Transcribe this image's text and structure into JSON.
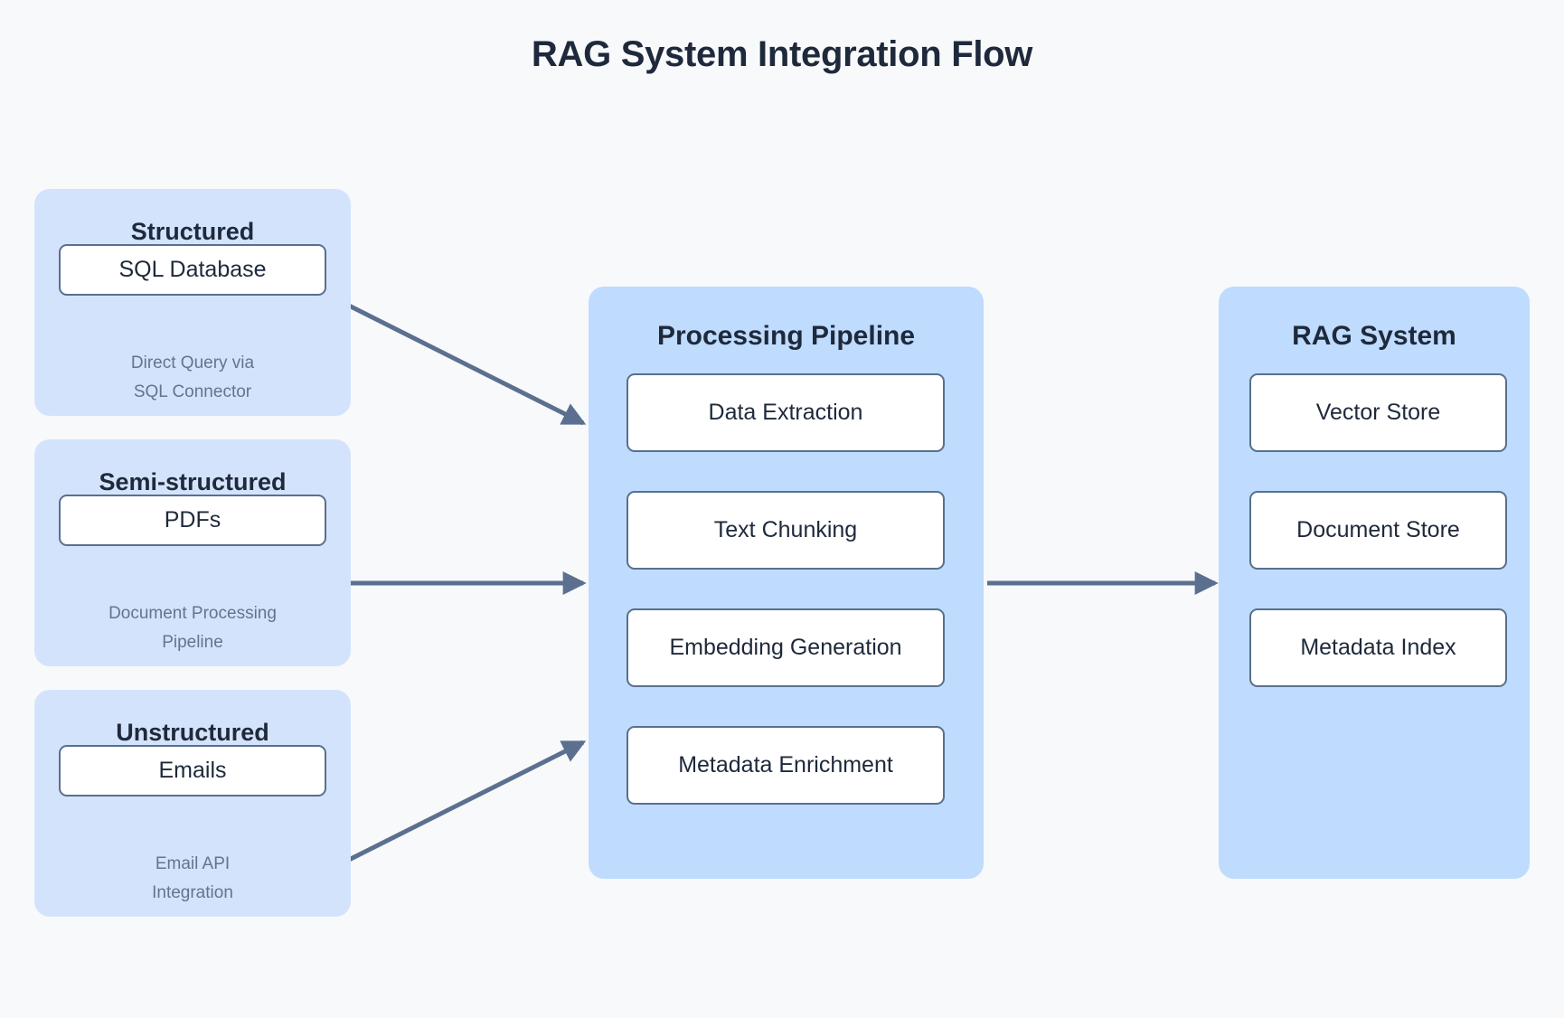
{
  "title": "RAG System Integration Flow",
  "colors": {
    "background": "#f8f9fb",
    "source_group_fill": "#d4e3fc",
    "main_group_fill": "#bfdbfe",
    "card_fill": "#ffffff",
    "card_border": "#58708e",
    "text_dark": "#1e293b",
    "text_muted": "#64748b",
    "arrow": "#5b7090"
  },
  "sources": [
    {
      "title": "Structured",
      "card": "SQL Database",
      "caption_line1": "Direct Query via",
      "caption_line2": "SQL Connector"
    },
    {
      "title": "Semi-structured",
      "card": "PDFs",
      "caption_line1": "Document Processing",
      "caption_line2": "Pipeline"
    },
    {
      "title": "Unstructured",
      "card": "Emails",
      "caption_line1": "Email API",
      "caption_line2": "Integration"
    }
  ],
  "pipeline": {
    "title": "Processing Pipeline",
    "stages": [
      "Data Extraction",
      "Text Chunking",
      "Embedding Generation",
      "Metadata Enrichment"
    ]
  },
  "rag": {
    "title": "RAG System",
    "stores": [
      "Vector Store",
      "Document Store",
      "Metadata Index"
    ]
  },
  "connections": [
    {
      "from": "Structured",
      "to": "Processing Pipeline"
    },
    {
      "from": "Semi-structured",
      "to": "Processing Pipeline"
    },
    {
      "from": "Unstructured",
      "to": "Processing Pipeline"
    },
    {
      "from": "Processing Pipeline",
      "to": "RAG System"
    }
  ]
}
